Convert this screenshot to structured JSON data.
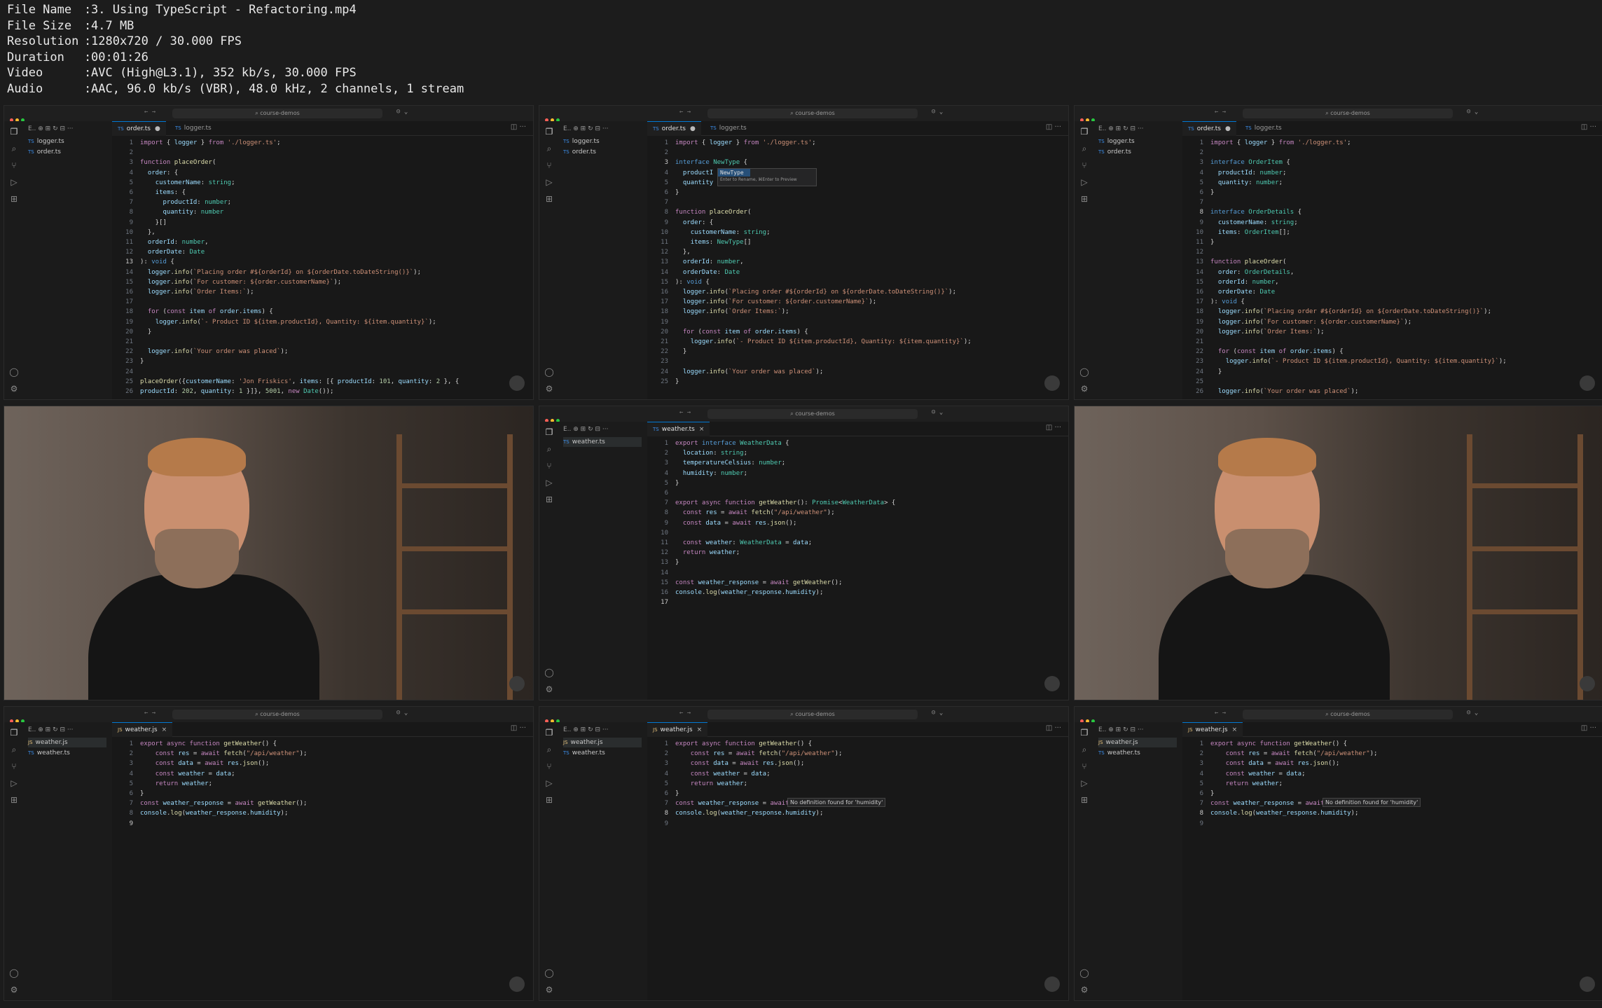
{
  "meta": {
    "rows": [
      {
        "key": "File Name",
        "value": "3. Using TypeScript - Refactoring.mp4"
      },
      {
        "key": "File Size",
        "value": "4.7 MB"
      },
      {
        "key": "Resolution",
        "value": "1280x720 / 30.000 FPS"
      },
      {
        "key": "Duration",
        "value": "00:01:26"
      },
      {
        "key": "Video",
        "value": "AVC (High@L3.1), 352 kb/s, 30.000 FPS"
      },
      {
        "key": "Audio",
        "value": "AAC, 96.0 kb/s (VBR), 48.0 kHz, 2 channels, 1 stream"
      }
    ]
  },
  "window": {
    "search": "course-demos"
  },
  "frames": [
    {
      "type": "editor",
      "files": [
        "logger.ts",
        "order.ts"
      ],
      "file_types": [
        "ts",
        "ts"
      ],
      "selected_file": -1,
      "tabs": [
        {
          "label": "order.ts",
          "type": "ts",
          "active": true,
          "mark": "●"
        },
        {
          "label": "logger.ts",
          "type": "ts",
          "active": false,
          "mark": ""
        }
      ],
      "current_line": 13,
      "lines": [
        "import { logger } from './logger.ts';",
        "",
        "function placeOrder(",
        "  order: {",
        "    customerName: string;",
        "    items: {",
        "      productId: number;",
        "      quantity: number",
        "    }[]",
        "  },",
        "  orderId: number,",
        "  orderDate: Date",
        "): void {",
        "  logger.info(`Placing order #${orderId} on ${orderDate.toDateString()}`);",
        "  logger.info(`For customer: ${order.customerName}`);",
        "  logger.info(`Order Items:`);",
        "",
        "  for (const item of order.items) {",
        "    logger.info(`- Product ID ${item.productId}, Quantity: ${item.quantity}`);",
        "  }",
        "",
        "  logger.info(`Your order was placed`);",
        "}",
        "",
        "placeOrder({customerName: 'Jon Friskics', items: [{ productId: 101, quantity: 2 }, {",
        "productId: 202, quantity: 1 }]}, 5001, new Date());"
      ]
    },
    {
      "type": "editor",
      "files": [
        "logger.ts",
        "order.ts"
      ],
      "file_types": [
        "ts",
        "ts"
      ],
      "selected_file": -1,
      "tabs": [
        {
          "label": "order.ts",
          "type": "ts",
          "active": true,
          "mark": "●"
        },
        {
          "label": "logger.ts",
          "type": "ts",
          "active": false,
          "mark": ""
        }
      ],
      "current_line": 3,
      "lines": [
        "import { logger } from './logger.ts';",
        "",
        "interface NewType {",
        "  productI",
        "  quantity",
        "}",
        "",
        "function placeOrder(",
        "  order: {",
        "    customerName: string;",
        "    items: NewType[]",
        "  },",
        "  orderId: number,",
        "  orderDate: Date",
        "): void {",
        "  logger.info(`Placing order #${orderId} on ${orderDate.toDateString()}`);",
        "  logger.info(`For customer: ${order.customerName}`);",
        "  logger.info(`Order Items:`);",
        "",
        "  for (const item of order.items) {",
        "    logger.info(`- Product ID ${item.productId}, Quantity: ${item.quantity}`);",
        "  }",
        "",
        "  logger.info(`Your order was placed`);",
        "}"
      ],
      "rename": {
        "value": "NewType",
        "hint": "Enter to Rename, ⌘Enter to Preview"
      }
    },
    {
      "type": "editor",
      "files": [
        "logger.ts",
        "order.ts"
      ],
      "file_types": [
        "ts",
        "ts"
      ],
      "selected_file": -1,
      "tabs": [
        {
          "label": "order.ts",
          "type": "ts",
          "active": true,
          "mark": "●"
        },
        {
          "label": "logger.ts",
          "type": "ts",
          "active": false,
          "mark": ""
        }
      ],
      "current_line": 8,
      "lines": [
        "import { logger } from './logger.ts';",
        "",
        "interface OrderItem {",
        "  productId: number;",
        "  quantity: number;",
        "}",
        "",
        "interface OrderDetails {",
        "  customerName: string;",
        "  items: OrderItem[];",
        "}",
        "",
        "function placeOrder(",
        "  order: OrderDetails,",
        "  orderId: number,",
        "  orderDate: Date",
        "): void {",
        "  logger.info(`Placing order #${orderId} on ${orderDate.toDateString()}`);",
        "  logger.info(`For customer: ${order.customerName}`);",
        "  logger.info(`Order Items:`);",
        "",
        "  for (const item of order.items) {",
        "    logger.info(`- Product ID ${item.productId}, Quantity: ${item.quantity}`);",
        "  }",
        "",
        "  logger.info(`Your order was placed`);"
      ]
    },
    {
      "type": "video"
    },
    {
      "type": "editor",
      "files": [
        "weather.ts"
      ],
      "file_types": [
        "ts"
      ],
      "selected_file": 0,
      "tabs": [
        {
          "label": "weather.ts",
          "type": "ts",
          "active": true,
          "mark": "×"
        }
      ],
      "current_line": 17,
      "lines": [
        "export interface WeatherData {",
        "  location: string;",
        "  temperatureCelsius: number;",
        "  humidity: number;",
        "}",
        "",
        "export async function getWeather(): Promise<WeatherData> {",
        "  const res = await fetch(\"/api/weather\");",
        "  const data = await res.json();",
        "",
        "  const weather: WeatherData = data;",
        "  return weather;",
        "}",
        "",
        "const weather_response = await getWeather();",
        "console.log(weather_response.humidity);",
        ""
      ]
    },
    {
      "type": "video"
    },
    {
      "type": "editor",
      "files": [
        "weather.js",
        "weather.ts"
      ],
      "file_types": [
        "js",
        "ts"
      ],
      "selected_file": 0,
      "tabs": [
        {
          "label": "weather.js",
          "type": "js",
          "active": true,
          "mark": "×"
        }
      ],
      "current_line": 9,
      "lines": [
        "export async function getWeather() {",
        "    const res = await fetch(\"/api/weather\");",
        "    const data = await res.json();",
        "    const weather = data;",
        "    return weather;",
        "}",
        "const weather_response = await getWeather();",
        "console.log(weather_response.humidity);",
        ""
      ]
    },
    {
      "type": "editor",
      "files": [
        "weather.js",
        "weather.ts"
      ],
      "file_types": [
        "js",
        "ts"
      ],
      "selected_file": 0,
      "tabs": [
        {
          "label": "weather.js",
          "type": "js",
          "active": true,
          "mark": "×"
        }
      ],
      "current_line": 8,
      "lines": [
        "export async function getWeather() {",
        "    const res = await fetch(\"/api/weather\");",
        "    const data = await res.json();",
        "    const weather = data;",
        "    return weather;",
        "}",
        "const weather_response = await getWeather();",
        "console.log(weather_response.humidity);",
        ""
      ],
      "tooltip": "No definition found for 'humidity'"
    },
    {
      "type": "editor",
      "files": [
        "weather.js",
        "weather.ts"
      ],
      "file_types": [
        "js",
        "ts"
      ],
      "selected_file": 0,
      "tabs": [
        {
          "label": "weather.js",
          "type": "js",
          "active": true,
          "mark": "×"
        }
      ],
      "current_line": 8,
      "lines": [
        "export async function getWeather() {",
        "    const res = await fetch(\"/api/weather\");",
        "    const data = await res.json();",
        "    const weather = data;",
        "    return weather;",
        "}",
        "const weather_response = await getWeather();",
        "console.log(weather_response.humidity);",
        ""
      ],
      "tooltip": "No definition found for 'humidity'"
    }
  ],
  "colors": {
    "accent": "#0078d4",
    "background": "#181818"
  }
}
